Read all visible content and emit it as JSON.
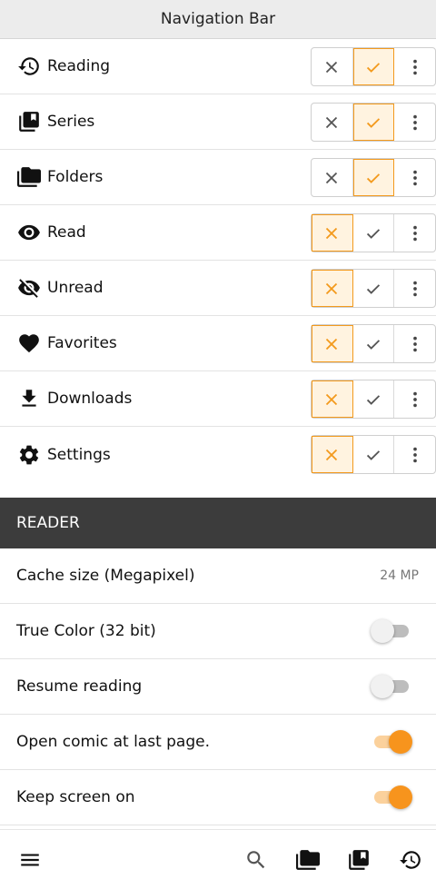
{
  "header": {
    "title": "Navigation Bar"
  },
  "nav_items": [
    {
      "label": "Reading",
      "icon": "history-icon",
      "selected": "check"
    },
    {
      "label": "Series",
      "icon": "library-book-icon",
      "selected": "check"
    },
    {
      "label": "Folders",
      "icon": "folder-icon",
      "selected": "check"
    },
    {
      "label": "Read",
      "icon": "eye-icon",
      "selected": "x"
    },
    {
      "label": "Unread",
      "icon": "eye-off-icon",
      "selected": "x"
    },
    {
      "label": "Favorites",
      "icon": "heart-icon",
      "selected": "x"
    },
    {
      "label": "Downloads",
      "icon": "download-icon",
      "selected": "x"
    },
    {
      "label": "Settings",
      "icon": "gear-icon",
      "selected": "x"
    }
  ],
  "reader": {
    "header": "READER",
    "cache": {
      "label": "Cache size (Megapixel)",
      "value": "24 MP"
    },
    "true_color": {
      "label": "True Color (32 bit)",
      "on": false
    },
    "resume": {
      "label": "Resume reading",
      "on": false
    },
    "last_page": {
      "label": "Open comic at last page.",
      "on": true
    },
    "keep_screen": {
      "label": "Keep screen on",
      "on": true
    }
  },
  "bottom_nav": [
    "menu-icon",
    "search-icon",
    "folder-icon",
    "library-book-icon",
    "history-icon"
  ],
  "colors": {
    "accent": "#f7941d",
    "accent_light": "#fff3e0",
    "header_bg": "#3c3c3c",
    "topbar_bg": "#ececec"
  }
}
